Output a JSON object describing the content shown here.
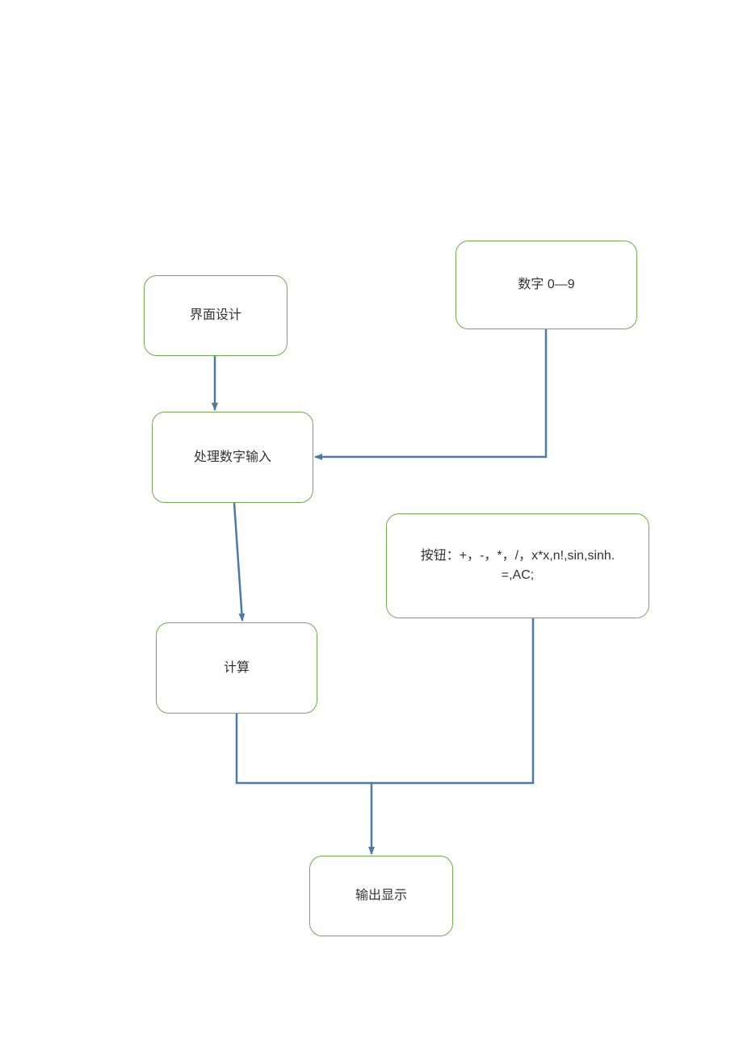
{
  "nodes": {
    "ui_design": {
      "label": "界面设计"
    },
    "digits": {
      "label": "数字 0—9"
    },
    "process_input": {
      "label": "处理数字输入"
    },
    "buttons": {
      "line1": "按钮：+，-，*，/，x*x,n!,sin,sinh.",
      "line2": "=,AC;"
    },
    "calculate": {
      "label": "计算"
    },
    "output": {
      "label": "输出显示"
    }
  },
  "colors": {
    "node_border": "#70ad47",
    "connector": "#4a7ba6"
  }
}
